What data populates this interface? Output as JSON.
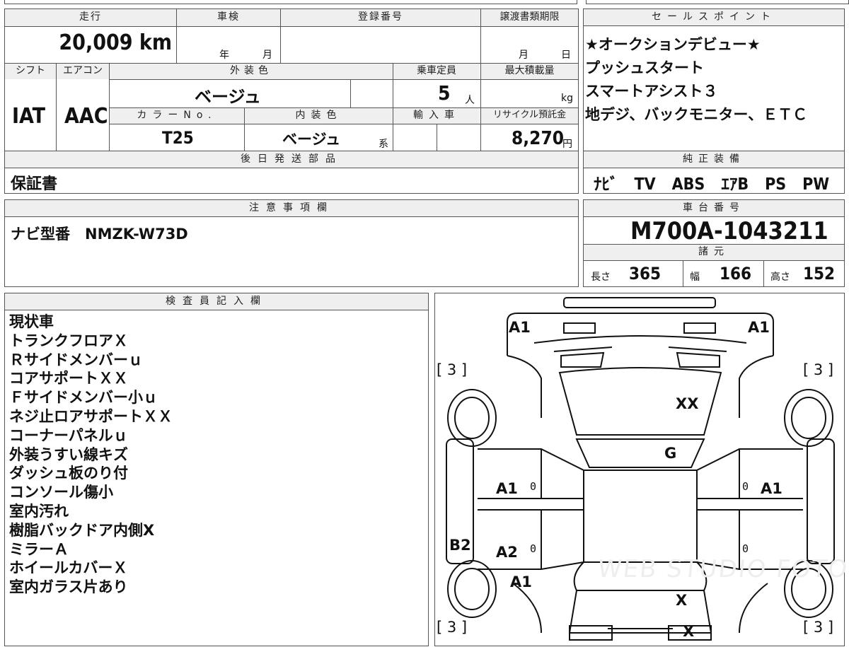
{
  "top": {
    "mileage_label": "走行",
    "mileage": "20,009 km",
    "inspection_label": "車検",
    "year_unit": "年",
    "month_unit": "月",
    "reg_label": "登録番号",
    "transfer_label": "譲渡書類期限",
    "transfer_month": "月",
    "transfer_day": "日",
    "shift_label": "シフト",
    "shift": "IAT",
    "ac_label": "エアコン",
    "ac": "AAC",
    "ext_color_label": "外装色",
    "ext_color": "ベージュ",
    "capacity_label": "乗車定員",
    "capacity": "5",
    "capacity_unit": "人",
    "load_label": "最大積載量",
    "load_unit": "kg",
    "color_no_label": "カラーNo.",
    "color_no": "T25",
    "int_color_label": "内装色",
    "int_color": "ベージュ",
    "int_color_suffix": "系",
    "import_label": "輸入車",
    "recycle_label": "リサイクル預託金",
    "recycle": "8,270",
    "recycle_unit": "円",
    "parts_label": "後日発送部品",
    "parts": "保証書"
  },
  "sales": {
    "label": "セールスポイント",
    "lines": [
      "★オークションデビュー★",
      "プッシュスタート",
      "スマートアシスト３",
      "地デジ、バックモニター、ＥＴＣ"
    ],
    "equipment_label": "純正装備",
    "equipment": "ﾅﾋﾞ　TV　ABS　ｴｱB　PS　PW"
  },
  "notes": {
    "label": "注意事項欄",
    "text": "ナビ型番　NMZK-W73D"
  },
  "chassis": {
    "label": "車台番号",
    "number": "M700A-1043211",
    "spec_label": "諸元",
    "length_label": "長さ",
    "length": "365",
    "width_label": "幅",
    "width": "166",
    "height_label": "高さ",
    "height": "152"
  },
  "inspector": {
    "label": "検査員記入欄",
    "lines": [
      "現状車",
      "トランクフロアＸ",
      "Ｒサイドメンバーｕ",
      "コアサポートＸＸ",
      "Ｆサイドメンバー小ｕ",
      "ネジ止ロアサポートＸＸ",
      "コーナーパネルｕ",
      "外装うすい線キズ",
      "ダッシュ板のり付",
      "コンソール傷小",
      "室内汚れ",
      "樹脂バックドア内側X",
      "ミラーＡ",
      "ホイールカバーＸ",
      "室内ガラス片あり"
    ]
  },
  "diagram": {
    "marks": {
      "front_left": "A1",
      "front_right": "A1",
      "tire_fl": "[ 3 ]",
      "tire_fr": "[ 3 ]",
      "tire_rl": "[ 3 ]",
      "tire_rr": "[ 3 ]",
      "hood": "XX",
      "windshield": "G",
      "door_fl": "A1",
      "door_fr": "A1",
      "door_rl": "A2",
      "side_rl": "B2",
      "fender_rl": "A1",
      "roof_rear": "X",
      "rear": "X",
      "zero": "0"
    },
    "watermark": "WEB STUDIO FOTO"
  }
}
